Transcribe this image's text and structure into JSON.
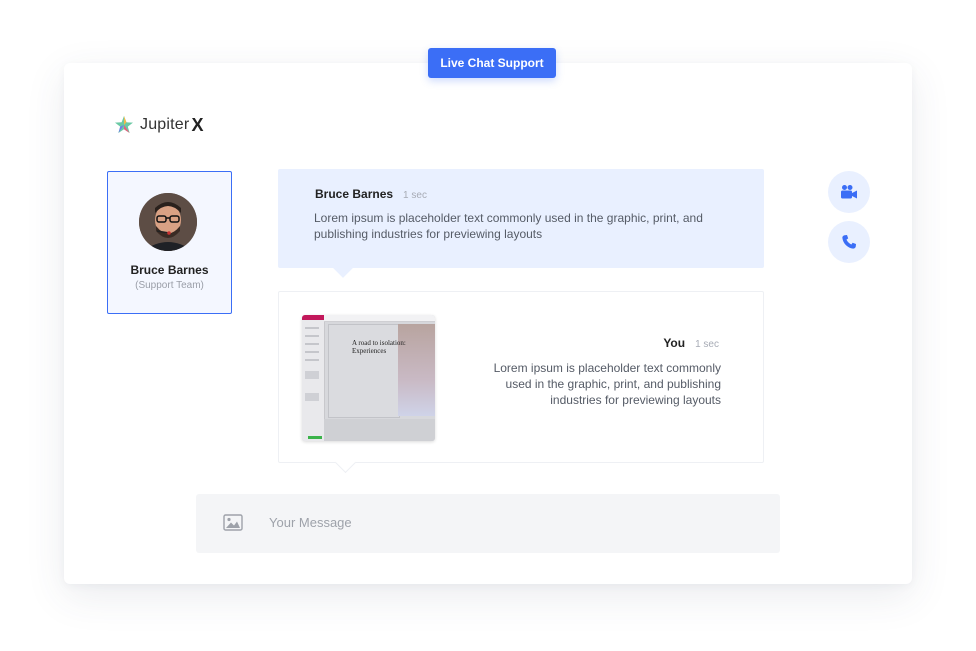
{
  "badge": {
    "label": "Live Chat Support"
  },
  "brand": {
    "name": "Jupiter",
    "mark": "X"
  },
  "agent": {
    "name": "Bruce Barnes",
    "team": "(Support Team)"
  },
  "messages": [
    {
      "sender": "Bruce Barnes",
      "time": "1 sec",
      "text": "Lorem ipsum is placeholder text commonly used in the graphic, print, and publishing industries for previewing layouts"
    },
    {
      "sender": "You",
      "time": "1 sec",
      "text": "Lorem ipsum is placeholder text commonly used in the graphic, print, and publishing industries for previewing layouts",
      "attachment": {
        "title": "A road to isolation: Experiences"
      }
    }
  ],
  "actions": {
    "video": "video-camera-icon",
    "phone": "phone-icon"
  },
  "composer": {
    "placeholder": "Your Message",
    "attach_icon": "image-icon"
  },
  "colors": {
    "accent": "#3b6ef6",
    "bubble": "#e9f0ff"
  }
}
